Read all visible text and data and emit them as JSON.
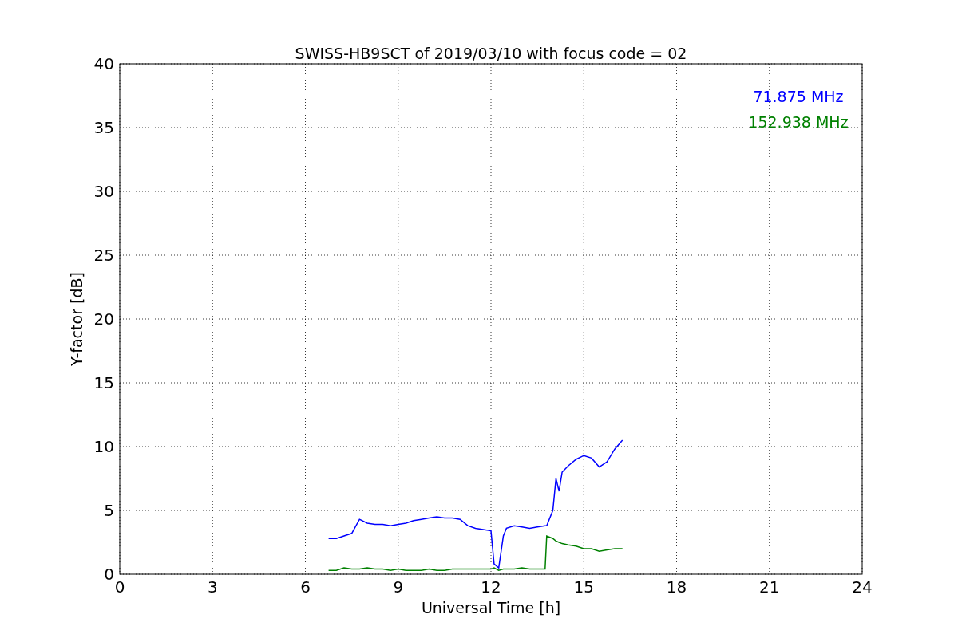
{
  "chart_data": {
    "type": "line",
    "title": "SWISS-HB9SCT of 2019/03/10 with focus code = 02",
    "xlabel": "Universal Time [h]",
    "ylabel": "Y-factor [dB]",
    "x": [
      6.75,
      7,
      7.25,
      7.5,
      7.75,
      8,
      8.25,
      8.5,
      8.75,
      9,
      9.25,
      9.5,
      9.75,
      10,
      10.25,
      10.5,
      10.75,
      11,
      11.25,
      11.5,
      11.75,
      12,
      12.1,
      12.25,
      12.4,
      12.5,
      12.75,
      13,
      13.25,
      13.5,
      13.75,
      13.8,
      14,
      14.1,
      14.2,
      14.3,
      14.5,
      14.75,
      15,
      15.25,
      15.5,
      15.75,
      16,
      16.25
    ],
    "series": [
      {
        "name": "71.875 MHz",
        "color": "#0000ff",
        "values": [
          2.8,
          2.8,
          3.0,
          3.2,
          4.3,
          4.0,
          3.9,
          3.9,
          3.8,
          3.9,
          4.0,
          4.2,
          4.3,
          4.4,
          4.5,
          4.4,
          4.4,
          4.3,
          3.8,
          3.6,
          3.5,
          3.4,
          0.8,
          0.5,
          3.0,
          3.6,
          3.8,
          3.7,
          3.6,
          3.7,
          3.8,
          3.8,
          5.0,
          7.5,
          6.5,
          8.0,
          8.5,
          9.0,
          9.3,
          9.1,
          8.4,
          8.8,
          9.8,
          10.5
        ]
      },
      {
        "name": "152.938 MHz",
        "color": "#008000",
        "values": [
          0.3,
          0.3,
          0.5,
          0.4,
          0.4,
          0.5,
          0.4,
          0.4,
          0.3,
          0.4,
          0.3,
          0.3,
          0.3,
          0.4,
          0.3,
          0.3,
          0.4,
          0.4,
          0.4,
          0.4,
          0.4,
          0.4,
          0.5,
          0.3,
          0.4,
          0.4,
          0.4,
          0.5,
          0.4,
          0.4,
          0.4,
          3.0,
          2.8,
          2.6,
          2.5,
          2.4,
          2.3,
          2.2,
          2.0,
          2.0,
          1.8,
          1.9,
          2.0,
          2.0
        ]
      }
    ],
    "xlim": [
      0,
      24
    ],
    "ylim": [
      0,
      40
    ],
    "xticks": [
      0,
      3,
      6,
      9,
      12,
      15,
      18,
      21,
      24
    ],
    "yticks": [
      0,
      5,
      10,
      15,
      20,
      25,
      30,
      35,
      40
    ],
    "grid": true
  }
}
